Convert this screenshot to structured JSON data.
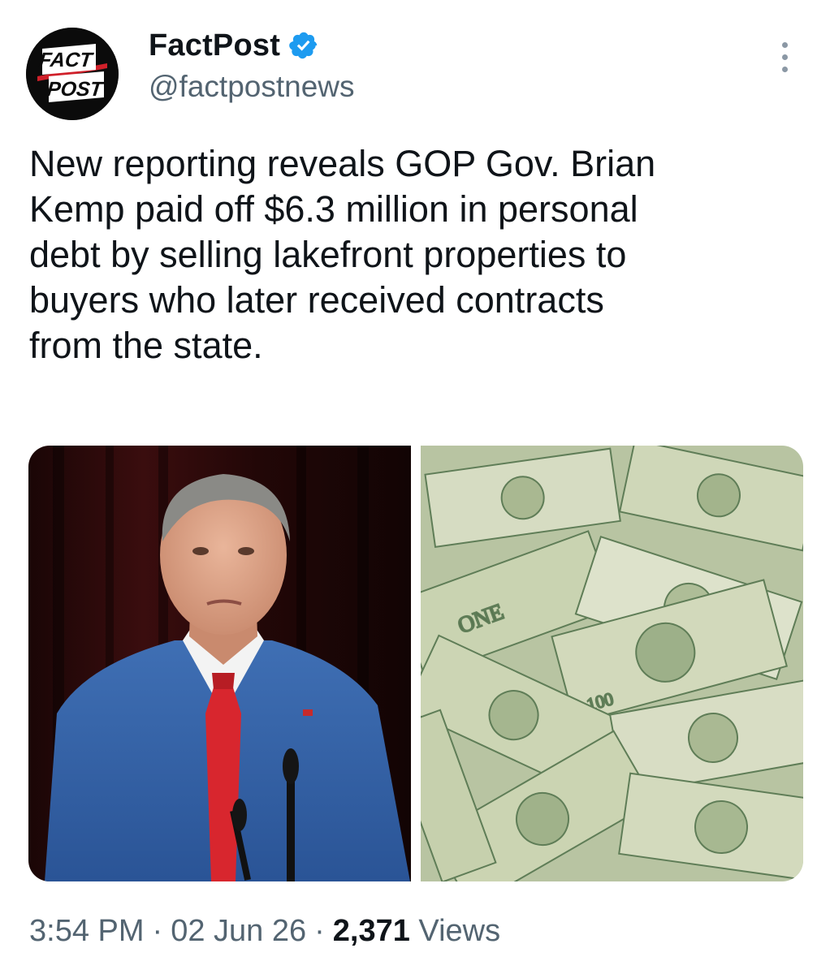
{
  "author": {
    "display_name": "FactPost",
    "handle": "@factpostnews",
    "avatar_text": [
      "FACT",
      "POST"
    ],
    "verified": true,
    "verified_color": "#1d9bf0"
  },
  "tweet": {
    "text": "New reporting reveals GOP Gov. Brian\nKemp paid off $6.3 million in personal\ndebt by selling lakefront properties to\nbuyers who later received contracts\nfrom the state."
  },
  "media": [
    {
      "kind": "photo",
      "subject": "man-in-blue-suit-at-podium"
    },
    {
      "kind": "photo",
      "subject": "pile-of-dollar-bills"
    }
  ],
  "meta": {
    "time": "3:54 PM",
    "separator": "·",
    "date": "02 Jun 26",
    "views_count": "2,371",
    "views_label": "Views"
  },
  "icons": {
    "verified": "verified-badge-icon",
    "more": "more-options-icon"
  },
  "colors": {
    "text_primary": "#0f1419",
    "text_secondary": "#536471",
    "accent": "#1d9bf0"
  }
}
